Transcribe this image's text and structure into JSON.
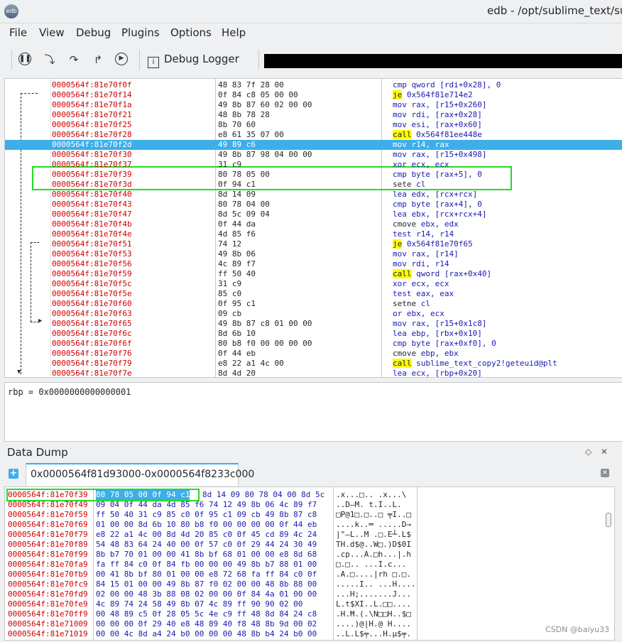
{
  "window": {
    "title": "edb - /opt/sublime_text/subli",
    "app_icon_text": "edb"
  },
  "menu": [
    "File",
    "View",
    "Debug",
    "Plugins",
    "Options",
    "Help"
  ],
  "toolbar": {
    "buttons": [
      "pause-icon",
      "step-into-icon",
      "step-over-icon",
      "step-out-icon",
      "run-icon"
    ],
    "logger_label": "Debug Logger"
  },
  "disassembly": [
    {
      "addr": "0000564f:81e70f0f",
      "bytes": "48 83 7f 28 00",
      "mn": "cmp",
      "ops": "qword [rdi+0x28], 0"
    },
    {
      "addr": "0000564f:81e70f14",
      "bytes": "0f 84 c8 05 00 00",
      "mn": "je",
      "ops": "0x564f81e714e2"
    },
    {
      "addr": "0000564f:81e70f1a",
      "bytes": "49 8b 87 60 02 00 00",
      "mn": "mov",
      "ops": "rax, [r15+0x260]"
    },
    {
      "addr": "0000564f:81e70f21",
      "bytes": "48 8b 78 28",
      "mn": "mov",
      "ops": "rdi, [rax+0x28]"
    },
    {
      "addr": "0000564f:81e70f25",
      "bytes": "8b 70 60",
      "mn": "mov",
      "ops": "esi, [rax+0x60]"
    },
    {
      "addr": "0000564f:81e70f28",
      "bytes": "e8 61 35 07 00",
      "mn": "call",
      "ops": "0x564f81ee448e"
    },
    {
      "addr": "0000564f:81e70f2d",
      "bytes": "49 89 c6",
      "mn": "mov",
      "ops": "r14, rax"
    },
    {
      "addr": "0000564f:81e70f30",
      "bytes": "49 8b 87 98 04 00 00",
      "mn": "mov",
      "ops": "rax, [r15+0x498]"
    },
    {
      "addr": "0000564f:81e70f37",
      "bytes": "31 c9",
      "mn": "xor",
      "ops": "ecx, ecx"
    },
    {
      "addr": "0000564f:81e70f39",
      "bytes": "80 78 05 00",
      "mn": "cmp",
      "ops": "byte [rax+5], 0"
    },
    {
      "addr": "0000564f:81e70f3d",
      "bytes": "0f 94 c1",
      "mn": "sete",
      "ops": "cl"
    },
    {
      "addr": "0000564f:81e70f40",
      "bytes": "8d 14 09",
      "mn": "lea",
      "ops": "edx, [rcx+rcx]"
    },
    {
      "addr": "0000564f:81e70f43",
      "bytes": "80 78 04 00",
      "mn": "cmp",
      "ops": "byte [rax+4], 0"
    },
    {
      "addr": "0000564f:81e70f47",
      "bytes": "8d 5c 09 04",
      "mn": "lea",
      "ops": "ebx, [rcx+rcx+4]"
    },
    {
      "addr": "0000564f:81e70f4b",
      "bytes": "0f 44 da",
      "mn": "cmove",
      "ops": "ebx, edx"
    },
    {
      "addr": "0000564f:81e70f4e",
      "bytes": "4d 85 f6",
      "mn": "test",
      "ops": "r14, r14"
    },
    {
      "addr": "0000564f:81e70f51",
      "bytes": "74 12",
      "mn": "je",
      "ops": "0x564f81e70f65"
    },
    {
      "addr": "0000564f:81e70f53",
      "bytes": "49 8b 06",
      "mn": "mov",
      "ops": "rax, [r14]"
    },
    {
      "addr": "0000564f:81e70f56",
      "bytes": "4c 89 f7",
      "mn": "mov",
      "ops": "rdi, r14"
    },
    {
      "addr": "0000564f:81e70f59",
      "bytes": "ff 50 40",
      "mn": "call",
      "ops": "qword [rax+0x40]"
    },
    {
      "addr": "0000564f:81e70f5c",
      "bytes": "31 c9",
      "mn": "xor",
      "ops": "ecx, ecx"
    },
    {
      "addr": "0000564f:81e70f5e",
      "bytes": "85 c0",
      "mn": "test",
      "ops": "eax, eax"
    },
    {
      "addr": "0000564f:81e70f60",
      "bytes": "0f 95 c1",
      "mn": "setne",
      "ops": "cl"
    },
    {
      "addr": "0000564f:81e70f63",
      "bytes": "09 cb",
      "mn": "or",
      "ops": "ebx, ecx"
    },
    {
      "addr": "0000564f:81e70f65",
      "bytes": "49 8b 87 c8 01 00 00",
      "mn": "mov",
      "ops": "rax, [r15+0x1c8]"
    },
    {
      "addr": "0000564f:81e70f6c",
      "bytes": "8d 6b 10",
      "mn": "lea",
      "ops": "ebp, [rbx+0x10]"
    },
    {
      "addr": "0000564f:81e70f6f",
      "bytes": "80 b8 f0 00 00 00 00",
      "mn": "cmp",
      "ops": "byte [rax+0xf0], 0"
    },
    {
      "addr": "0000564f:81e70f76",
      "bytes": "0f 44 eb",
      "mn": "cmove",
      "ops": "ebp, ebx"
    },
    {
      "addr": "0000564f:81e70f79",
      "bytes": "e8 22 a1 4c 00",
      "mn": "call",
      "ops": "sublime_text_copy2!geteuid@plt"
    },
    {
      "addr": "0000564f:81e70f7e",
      "bytes": "8d 4d 20",
      "mn": "lea",
      "ops": "ecx, [rbp+0x20]"
    }
  ],
  "selected_row": 6,
  "register_line": "rbp = 0x0000000000000001",
  "data_dump": {
    "title": "Data Dump",
    "tab_label": "0x0000564f81d93000-0x0000564f8233c000",
    "rows": [
      {
        "a": "0000564f:81e70f39",
        "sel": "80 78 05 00 0f 94 c1",
        "h": "8d 14 09 80 78 04 00 8d 5c",
        "c": ".x...□.. .x...\\"
      },
      {
        "a": "0000564f:81e70f49",
        "sel": "",
        "h": "09 04 0f 44 da 4d 85 f6 74 12 49 8b 06 4c 89 f7",
        "c": "..D—M. t.I..L."
      },
      {
        "a": "0000564f:81e70f59",
        "sel": "",
        "h": "ff 50 40 31 c9 85 c0 0f 95 c1 09 cb 49 8b 87 c8",
        "c": "□P@1□.□..□ ╤I..□"
      },
      {
        "a": "0000564f:81e70f69",
        "sel": "",
        "h": "01 00 00 8d 6b 10 80 b8 f0 00 00 00 00 0f 44 eb",
        "c": "....k..═ .....D→"
      },
      {
        "a": "0000564f:81e70f79",
        "sel": "",
        "h": "e8 22 a1 4c 00 8d 4d 20 85 c0 0f 45 cd 89 4c 24",
        "c": "|\"—L..M .□.E┴.L$"
      },
      {
        "a": "0000564f:81e70f89",
        "sel": "",
        "h": "54 48 83 64 24 40 00 0f 57 c0 0f 29 44 24 30 49",
        "c": "TH.d$@..W□.)D$0I"
      },
      {
        "a": "0000564f:81e70f99",
        "sel": "",
        "h": "8b b7 70 01 00 00 41 8b bf 68 01 00 00 e8 8d 68",
        "c": ".cp...A.□h...|.h"
      },
      {
        "a": "0000564f:81e70fa9",
        "sel": "",
        "h": "fa ff 84 c0 0f 84 fb 00 00 00 49 8b b7 88 01 00",
        "c": " □.□.. ...I.c..."
      },
      {
        "a": "0000564f:81e70fb9",
        "sel": "",
        "h": "00 41 8b bf 80 01 00 00 e8 72 68 fa ff 84 c0 0f",
        "c": ".A.□....|rh □.□."
      },
      {
        "a": "0000564f:81e70fc9",
        "sel": "",
        "h": "84 15 01 00 00 49 8b 87 f0 02 00 00 48 8b 88 00",
        "c": ".....I.. ...H...."
      },
      {
        "a": "0000564f:81e70fd9",
        "sel": "",
        "h": "02 00 00 48 3b 88 08 02 00 00 0f 84 4a 01 00 00",
        "c": "...H;.......J..."
      },
      {
        "a": "0000564f:81e70fe9",
        "sel": "",
        "h": "4c 89 74 24 58 49 8b 07 4c 89 ff 90 90 02 00",
        "c": "L.t$XI..L.□□...."
      },
      {
        "a": "0000564f:81e70ff9",
        "sel": "",
        "h": "00 48 89 c5 0f 28 05 5c 4e c9 ff 48 8d 84 24 c8",
        "c": ".H.Ħ.(.\\N□□H..$□"
      },
      {
        "a": "0000564f:81e71009",
        "sel": "",
        "h": "00 00 00 0f 29 40 e8 48 89 40 f8 48 8b 9d 00 02",
        "c": "....)@|H.@ H...."
      },
      {
        "a": "0000564f:81e71019",
        "sel": "",
        "h": "00 00 4c 8d a4 24 b0 00 00 00 48 8b b4 24 b0 00",
        "c": "..L.L$╤...H.µ$╤."
      }
    ]
  },
  "watermark": "CSDN @baiyu33"
}
